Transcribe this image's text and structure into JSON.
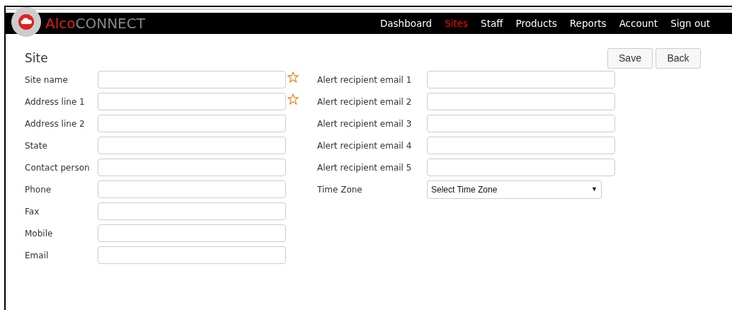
{
  "logo": {
    "part_1": "Alco",
    "part_2": "CONNECT"
  },
  "nav": [
    {
      "label": "Dashboard",
      "selected": false
    },
    {
      "label": "Sites",
      "selected": true
    },
    {
      "label": "Staff",
      "selected": false
    },
    {
      "label": "Products",
      "selected": false
    },
    {
      "label": "Reports",
      "selected": false
    },
    {
      "label": "Account",
      "selected": false
    },
    {
      "label": "Sign out",
      "selected": false
    }
  ],
  "page_title": "Site",
  "buttons": [
    "Save",
    "Back"
  ],
  "left_fields": [
    {
      "label": "Site name",
      "kind": "text",
      "required": true
    },
    {
      "label": "Address line 1",
      "kind": "text",
      "required": true
    },
    {
      "label": "Address line 2",
      "kind": "text",
      "required": false
    },
    {
      "label": "State",
      "kind": "text",
      "required": false
    },
    {
      "label": "Contact person",
      "kind": "text",
      "required": false
    },
    {
      "label": "Phone",
      "kind": "text",
      "required": false
    },
    {
      "label": "Fax",
      "kind": "text",
      "required": false
    },
    {
      "label": "Mobile",
      "kind": "text",
      "required": false
    },
    {
      "label": "Email",
      "kind": "text",
      "required": false
    }
  ],
  "right_fields": [
    {
      "label": "Alert recipient email 1",
      "kind": "text",
      "required": false
    },
    {
      "label": "Alert recipient email 2",
      "kind": "text",
      "required": false
    },
    {
      "label": "Alert recipient email 3",
      "kind": "text",
      "required": false
    },
    {
      "label": "Alert recipient email 4",
      "kind": "text",
      "required": false
    },
    {
      "label": "Alert recipient email 5",
      "kind": "text",
      "required": false
    },
    {
      "label": "Time Zone",
      "kind": "select",
      "value": "Select Time Zone",
      "arrow": "▼"
    }
  ]
}
